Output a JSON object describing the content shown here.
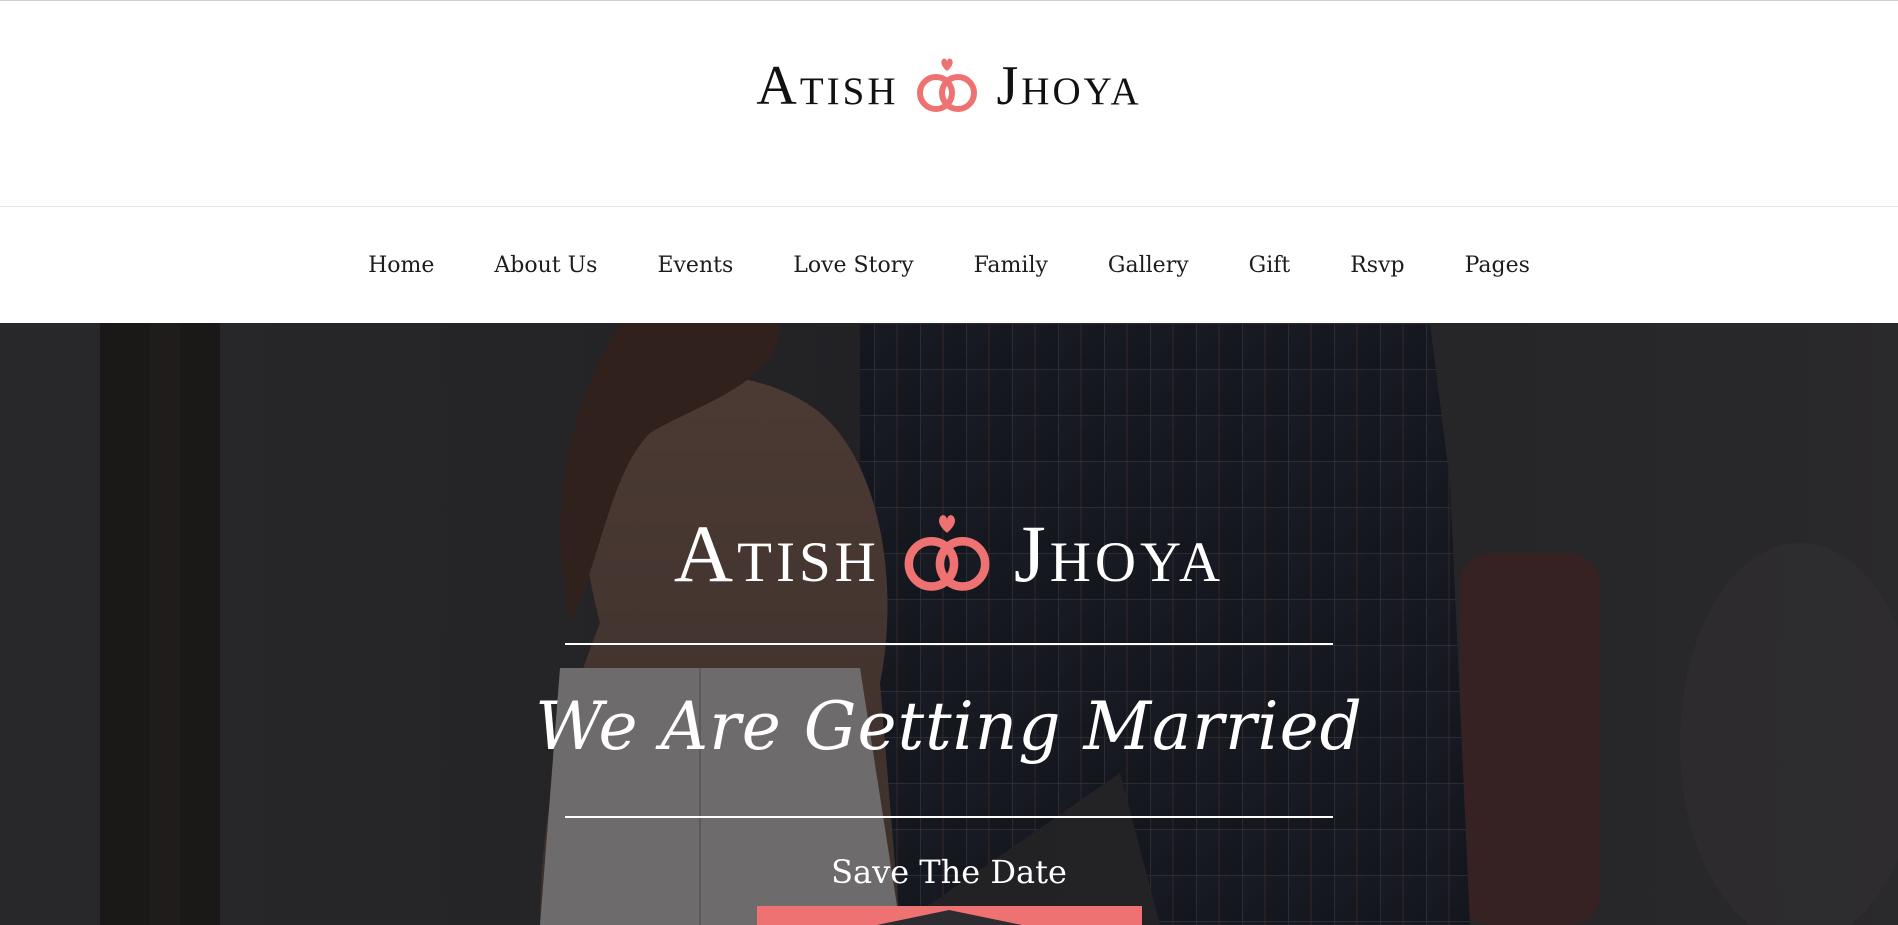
{
  "brand": {
    "name_left": "Atish",
    "name_right": "Jhoya",
    "accent_color": "#ef7272"
  },
  "nav": {
    "items": [
      {
        "label": "Home"
      },
      {
        "label": "About Us"
      },
      {
        "label": "Events"
      },
      {
        "label": "Love Story"
      },
      {
        "label": "Family"
      },
      {
        "label": "Gallery"
      },
      {
        "label": "Gift"
      },
      {
        "label": "Rsvp"
      },
      {
        "label": "Pages"
      }
    ]
  },
  "hero": {
    "name_left": "Atish",
    "name_right": "Jhoya",
    "tagline": "We Are Getting Married",
    "save_date": "Save The Date",
    "icons": {
      "rings": "wedding-rings-icon"
    }
  }
}
